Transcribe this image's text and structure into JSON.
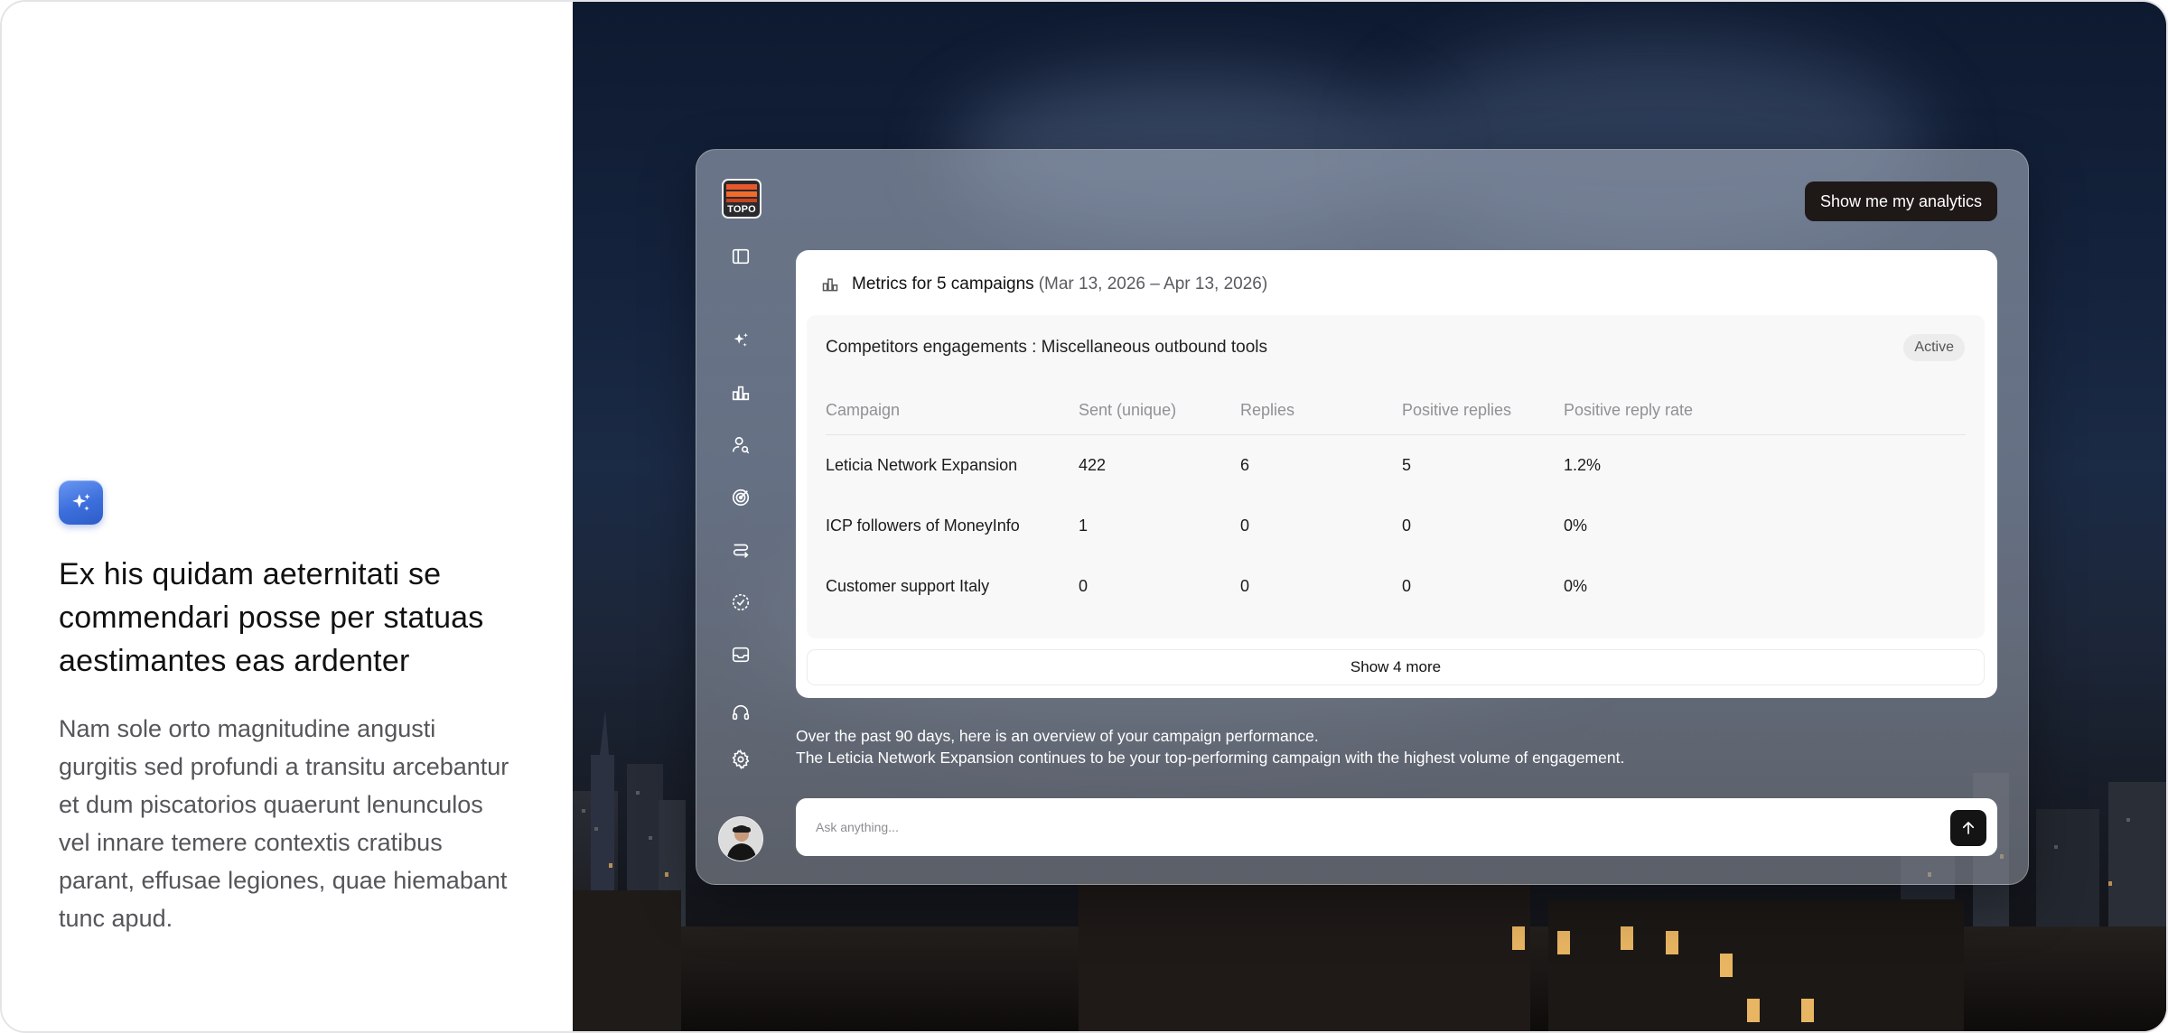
{
  "left_panel": {
    "icon": "sparkles-icon",
    "headline": "Ex his quidam aeternitati se commendari posse per statuas aestimantes eas ardenter",
    "body": "Nam sole orto magnitudine angusti gurgitis sed profundi a transitu arcebantur et dum piscatorios quaerunt lenunculos vel innare temere contextis cratibus parant, effusae legiones, quae hiemabant tunc apud."
  },
  "app": {
    "logo_text": "TOPO",
    "rail_icons": [
      "sidebar-toggle-icon",
      "sparkles-icon",
      "bar-chart-icon",
      "user-search-icon",
      "target-icon",
      "route-icon",
      "check-circle-icon",
      "inbox-icon",
      "headset-icon",
      "gear-icon"
    ],
    "analytics_button": "Show me my analytics",
    "metrics": {
      "title": "Metrics for 5 campaigns",
      "date_range": "(Mar 13, 2026 – Apr 13, 2026)",
      "campaign_name": "Competitors engagements : Miscellaneous outbound tools",
      "status": "Active",
      "columns": [
        "Campaign",
        "Sent (unique)",
        "Replies",
        "Positive replies",
        "Positive reply rate"
      ],
      "rows": [
        [
          "Leticia Network Expansion",
          "422",
          "6",
          "5",
          "1.2%"
        ],
        [
          "ICP followers of MoneyInfo",
          "1",
          "0",
          "0",
          "0%"
        ],
        [
          "Customer support Italy",
          "0",
          "0",
          "0",
          "0%"
        ]
      ],
      "show_more": "Show 4 more"
    },
    "summary_line1": "Over the past 90 days, here is an overview of your campaign performance.",
    "summary_line2": "The Leticia Network Expansion continues to be your top-performing campaign with the highest volume of engagement.",
    "ask_placeholder": "Ask anything...",
    "ask_value": ""
  },
  "colors": {
    "badge_blue": "#3c6fdc",
    "dark_button": "#1e1817",
    "logo_orange": "#e8582a"
  }
}
